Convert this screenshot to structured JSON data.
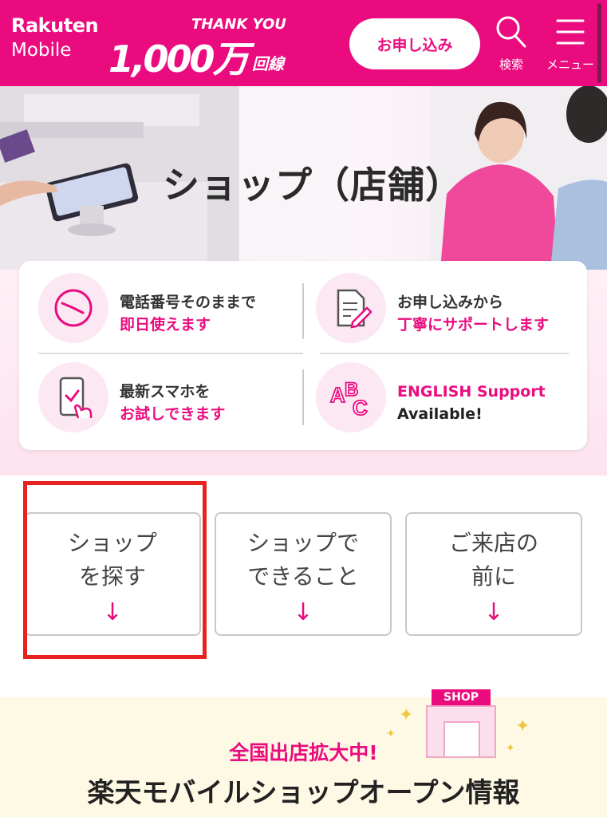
{
  "header": {
    "logo_line1": "Rakuten",
    "logo_line2": "Mobile",
    "thanks_top": "THANK YOU",
    "thanks_big": "1,000万",
    "thanks_unit": "回線",
    "apply_label": "お申し込み",
    "search_label": "検索",
    "menu_label": "メニュー",
    "brand_color": "#ea0c7f"
  },
  "hero": {
    "title": "ショップ（店舗）"
  },
  "features": [
    {
      "icon": "clock-icon",
      "line1": "電話番号そのままで",
      "line2": "即日使えます"
    },
    {
      "icon": "document-pen-icon",
      "line1": "お申し込みから",
      "line2": "丁寧にサポートします"
    },
    {
      "icon": "smartphone-touch-icon",
      "line1": "最新スマホを",
      "line2": "お試しできます"
    },
    {
      "icon": "abc-icon",
      "line1": "ENGLISH Support",
      "line2": "Available!"
    }
  ],
  "nav_buttons": [
    {
      "line1": "ショップ",
      "line2": "を探す",
      "arrow": "↓"
    },
    {
      "line1": "ショップで",
      "line2": "できること",
      "arrow": "↓"
    },
    {
      "line1": "ご来店の",
      "line2": "前に",
      "arrow": "↓"
    }
  ],
  "banner": {
    "shop_tag": "SHOP",
    "subtitle": "全国出店拡大中!",
    "title": "楽天モバイルショップオープン情報"
  }
}
